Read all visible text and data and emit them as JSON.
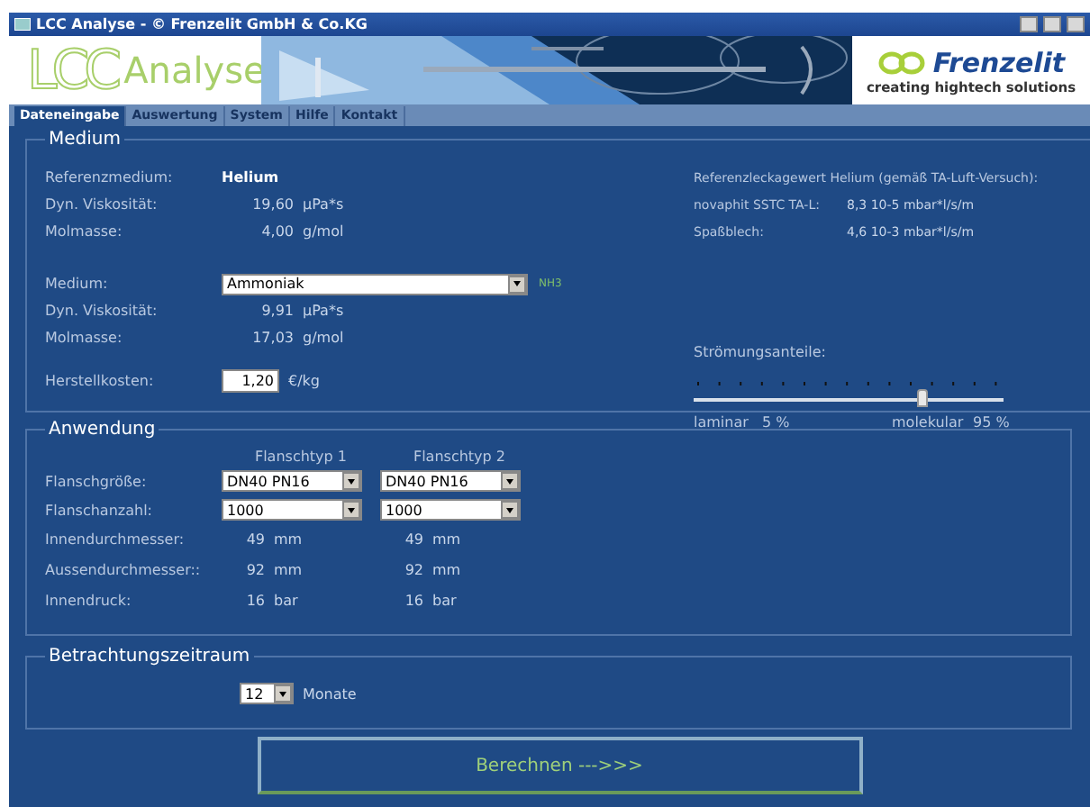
{
  "window": {
    "title": "LCC Analyse - © Frenzelit GmbH & Co.KG"
  },
  "banner": {
    "logo_main": "LCC",
    "logo_sub": "Analyse",
    "brand": "Frenzelit",
    "slogan": "creating hightech solutions"
  },
  "tabs": [
    {
      "label": "Dateneingabe",
      "selected": true
    },
    {
      "label": "Auswertung",
      "selected": false
    },
    {
      "label": "System",
      "selected": false
    },
    {
      "label": "Hilfe",
      "selected": false
    },
    {
      "label": "Kontakt",
      "selected": false
    }
  ],
  "medium": {
    "legend": "Medium",
    "reference": {
      "label": "Referenzmedium:",
      "value": "Helium"
    },
    "reference_props": [
      {
        "label": "Dyn. Viskosität:",
        "value": "19,60",
        "unit": "µPa*s"
      },
      {
        "label": "Molmasse:",
        "value": "4,00",
        "unit": "g/mol"
      }
    ],
    "selector": {
      "label": "Medium:",
      "value": "Ammoniak",
      "note": "NH3"
    },
    "props": [
      {
        "label": "Dyn. Viskosität:",
        "value": "9,91",
        "unit": "µPa*s"
      },
      {
        "label": "Molmasse:",
        "value": "17,03",
        "unit": "g/mol"
      }
    ],
    "cost": {
      "label": "Herstellkosten:",
      "value": "1,20",
      "unit": "€/kg"
    },
    "leak": {
      "title": "Referenzleckagewert Helium (gemäß TA-Luft-Versuch):",
      "rows": [
        {
          "label": "novaphit SSTC TA-L:",
          "value": "8,3 10-5 mbar*l/s/m"
        },
        {
          "label": "Spaßblech:",
          "value": "4,6 10-3 mbar*l/s/m"
        }
      ]
    },
    "flow": {
      "label": "Strömungsanteile:",
      "level": 0.74,
      "left_label": "laminar",
      "left_value": "5 %",
      "right_label": "molekular",
      "right_value": "95 %"
    }
  },
  "application": {
    "legend": "Anwendung",
    "columns": [
      "Flanschtyp 1",
      "Flanschtyp 2"
    ],
    "rows": [
      {
        "label": "Flanschgröße:",
        "kind": "select",
        "values": [
          {
            "value": "DN40 PN16"
          },
          {
            "value": "DN40 PN16"
          }
        ]
      },
      {
        "label": "Flanschanzahl:",
        "kind": "select",
        "values": [
          {
            "value": "1000"
          },
          {
            "value": "1000"
          }
        ]
      },
      {
        "label": "Innendurchmesser:",
        "kind": "text",
        "values": [
          {
            "value": "49",
            "unit": "mm"
          },
          {
            "value": "49",
            "unit": "mm"
          }
        ]
      },
      {
        "label": "Aussendurchmesser::",
        "kind": "text",
        "values": [
          {
            "value": "92",
            "unit": "mm"
          },
          {
            "value": "92",
            "unit": "mm"
          }
        ]
      },
      {
        "label": "Innendruck:",
        "kind": "text",
        "values": [
          {
            "value": "16",
            "unit": "bar"
          },
          {
            "value": "16",
            "unit": "bar"
          }
        ]
      }
    ]
  },
  "period": {
    "legend": "Betrachtungszeitraum",
    "value": "12",
    "unit": "Monate"
  },
  "calculate_button": "Berechnen --->>>"
}
